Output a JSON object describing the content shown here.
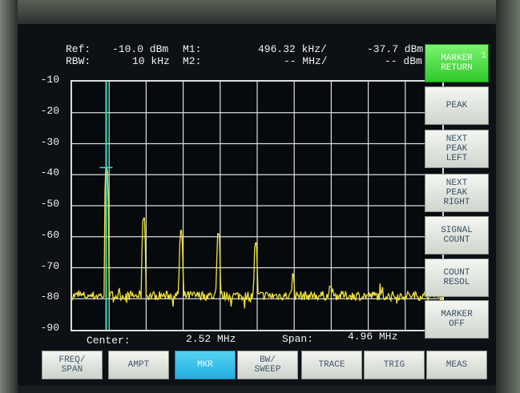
{
  "header": {
    "ref_label": "Ref:",
    "ref_value": "-10.0 dBm",
    "rbw_label": "RBW:",
    "rbw_value": "10 kHz",
    "m1_label": "M1:",
    "m1_freq": "496.32 kHz/",
    "m1_ampl": "-37.7 dBm",
    "m2_label": "M2:",
    "m2_freq": "-- MHz/",
    "m2_ampl": "-- dBm"
  },
  "footer": {
    "center_label": "Center:",
    "center_value": "2.52 MHz",
    "span_label": "Span:",
    "span_value": "4.96 MHz"
  },
  "softkeys": [
    {
      "label": "MARKER\nRETURN",
      "marker_num": "1"
    },
    {
      "label": "PEAK"
    },
    {
      "label": "NEXT\nPEAK\nLEFT"
    },
    {
      "label": "NEXT\nPEAK\nRIGHT"
    },
    {
      "label": "SIGNAL\nCOUNT"
    },
    {
      "label": "COUNT\nRESOL"
    },
    {
      "label": "MARKER\nOFF"
    }
  ],
  "menu_tabs": [
    {
      "label": "FREQ/\nSPAN"
    },
    {
      "label": "AMPT"
    },
    {
      "label": "MKR"
    },
    {
      "label": "BW/\nSWEEP"
    },
    {
      "label": "TRACE"
    },
    {
      "label": "TRIG"
    },
    {
      "label": "MEAS"
    }
  ],
  "active_menu": "MKR",
  "colors": {
    "trace": "#f2e23a",
    "marker_line": "#38e0c8",
    "grid": "#d8dede",
    "active_softkey": "#3fd63c",
    "active_tab": "#37c0e8"
  },
  "chart_data": {
    "type": "line",
    "y_tick_labels": [
      "-10",
      "-20",
      "-30",
      "-40",
      "-50",
      "-60",
      "-70",
      "-80",
      "-90"
    ],
    "ylim": [
      -90,
      -10
    ],
    "xlim_mhz": [
      0.04,
      5.0
    ],
    "grid": true,
    "marker": {
      "freq_mhz": 0.49632,
      "ampl_dbm": -37.7
    },
    "noise_floor_dbm": -79,
    "peaks": [
      {
        "freq_mhz": 0.5,
        "ampl_dbm": -37.7
      },
      {
        "freq_mhz": 1.0,
        "ampl_dbm": -54
      },
      {
        "freq_mhz": 1.5,
        "ampl_dbm": -58
      },
      {
        "freq_mhz": 2.0,
        "ampl_dbm": -59
      },
      {
        "freq_mhz": 2.5,
        "ampl_dbm": -62
      },
      {
        "freq_mhz": 3.0,
        "ampl_dbm": -72
      },
      {
        "freq_mhz": 3.5,
        "ampl_dbm": -76
      }
    ]
  }
}
